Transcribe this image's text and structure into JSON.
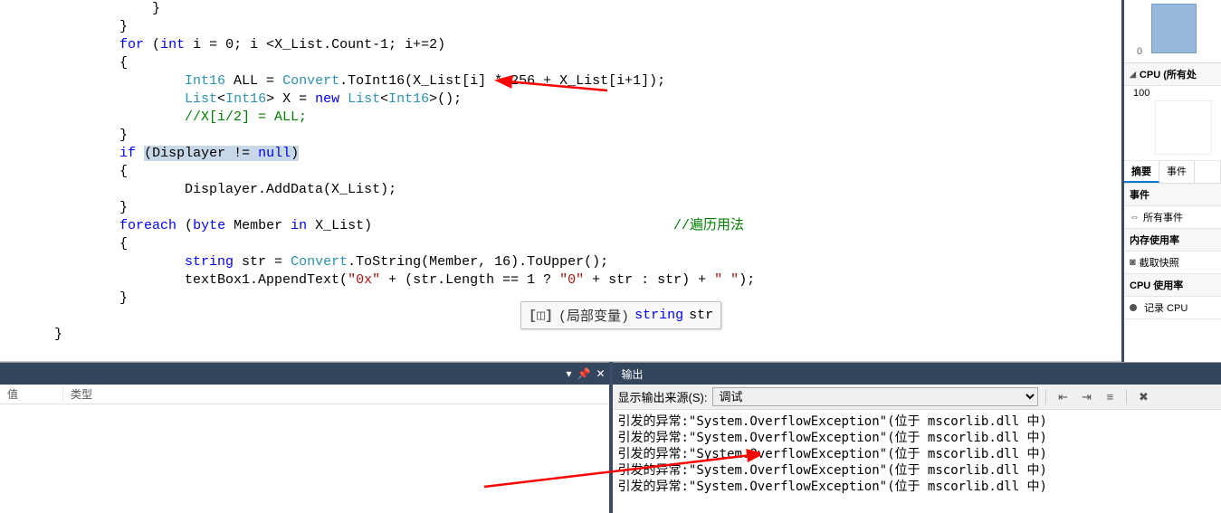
{
  "code": {
    "lines": [
      {
        "indent": 4,
        "segs": [
          {
            "t": "}"
          }
        ]
      },
      {
        "indent": 3,
        "segs": [
          {
            "t": "}"
          }
        ]
      },
      {
        "indent": 3,
        "segs": [
          {
            "t": "for",
            "c": "k-blue"
          },
          {
            "t": " ("
          },
          {
            "t": "int",
            "c": "k-blue"
          },
          {
            "t": " i = 0; i <X_List.Count-1; i+=2)"
          }
        ]
      },
      {
        "indent": 3,
        "segs": [
          {
            "t": "{"
          }
        ]
      },
      {
        "indent": 5,
        "segs": [
          {
            "t": "Int16",
            "c": "k-type"
          },
          {
            "t": " ALL = "
          },
          {
            "t": "Convert",
            "c": "k-type"
          },
          {
            "t": ".ToInt16(X_List[i] * 256 + X_List[i+1]);"
          }
        ]
      },
      {
        "indent": 5,
        "segs": [
          {
            "t": "List",
            "c": "k-type"
          },
          {
            "t": "<"
          },
          {
            "t": "Int16",
            "c": "k-type"
          },
          {
            "t": "> X = "
          },
          {
            "t": "new",
            "c": "k-blue"
          },
          {
            "t": " "
          },
          {
            "t": "List",
            "c": "k-type"
          },
          {
            "t": "<"
          },
          {
            "t": "Int16",
            "c": "k-type"
          },
          {
            "t": ">();"
          }
        ]
      },
      {
        "indent": 5,
        "segs": [
          {
            "t": "//X[i/2] = ALL;",
            "c": "k-comment"
          }
        ]
      },
      {
        "indent": 3,
        "segs": [
          {
            "t": "}"
          }
        ]
      },
      {
        "indent": 3,
        "segs": [
          {
            "t": "if",
            "c": "k-blue"
          },
          {
            "t": " "
          },
          {
            "t": "(Displayer != ",
            "c": "hl-bg"
          },
          {
            "t": "null",
            "c": "k-blue hl-bg"
          },
          {
            "t": ")",
            "c": "hl-bg"
          }
        ]
      },
      {
        "indent": 3,
        "segs": [
          {
            "t": "{"
          }
        ]
      },
      {
        "indent": 5,
        "segs": [
          {
            "t": "Displayer.AddData(X_List);"
          }
        ]
      },
      {
        "indent": 3,
        "segs": [
          {
            "t": "}"
          }
        ]
      },
      {
        "indent": 3,
        "segs": [
          {
            "t": "foreach",
            "c": "k-blue"
          },
          {
            "t": " ("
          },
          {
            "t": "byte",
            "c": "k-blue"
          },
          {
            "t": " Member "
          },
          {
            "t": "in",
            "c": "k-blue"
          },
          {
            "t": " X_List)"
          }
        ],
        "extra": {
          "t": "//遍历用法",
          "c": "k-comment",
          "px": 720
        }
      },
      {
        "indent": 3,
        "segs": [
          {
            "t": "{"
          }
        ]
      },
      {
        "indent": 5,
        "segs": [
          {
            "t": "string",
            "c": "k-blue"
          },
          {
            "t": " str = "
          },
          {
            "t": "Convert",
            "c": "k-type"
          },
          {
            "t": ".ToString(Member, 16).ToUpper();"
          }
        ]
      },
      {
        "indent": 5,
        "segs": [
          {
            "t": "textBox1.AppendText("
          },
          {
            "t": "\"0x\"",
            "c": "k-str"
          },
          {
            "t": " + (str.Length == 1 ? "
          },
          {
            "t": "\"0\"",
            "c": "k-str"
          },
          {
            "t": " + str : str) + "
          },
          {
            "t": "\" \"",
            "c": "k-str"
          },
          {
            "t": ");"
          }
        ]
      },
      {
        "indent": 3,
        "segs": [
          {
            "t": "}"
          }
        ]
      },
      {
        "indent": 0,
        "segs": [
          {
            "t": ""
          }
        ]
      },
      {
        "indent": 1,
        "segs": [
          {
            "t": "}"
          }
        ]
      }
    ]
  },
  "tooltip": {
    "icon": "[◫]",
    "local_label": "(局部变量)",
    "type": "string",
    "name": "str"
  },
  "locals": {
    "col_value": "值",
    "col_type": "类型"
  },
  "output": {
    "title": "输出",
    "source_label": "显示输出来源(S):",
    "selected": "调试",
    "lines": [
      "引发的异常:\"System.OverflowException\"(位于 mscorlib.dll 中)",
      "引发的异常:\"System.OverflowException\"(位于 mscorlib.dll 中)",
      "引发的异常:\"System.OverflowException\"(位于 mscorlib.dll 中)",
      "引发的异常:\"System.OverflowException\"(位于 mscorlib.dll 中)",
      "引发的异常:\"System.OverflowException\"(位于 mscorlib.dll 中)"
    ]
  },
  "diag": {
    "axis0": "0",
    "cpu_title": "CPU (所有处",
    "v100": "100",
    "tab_summary": "摘要",
    "tab_events": "事件",
    "sec_events": "事件",
    "all_events": "所有事件",
    "mem_usage": "内存使用率",
    "snapshot": "截取快照",
    "cpu_usage": "CPU 使用率",
    "record_cpu": "记录 CPU"
  }
}
